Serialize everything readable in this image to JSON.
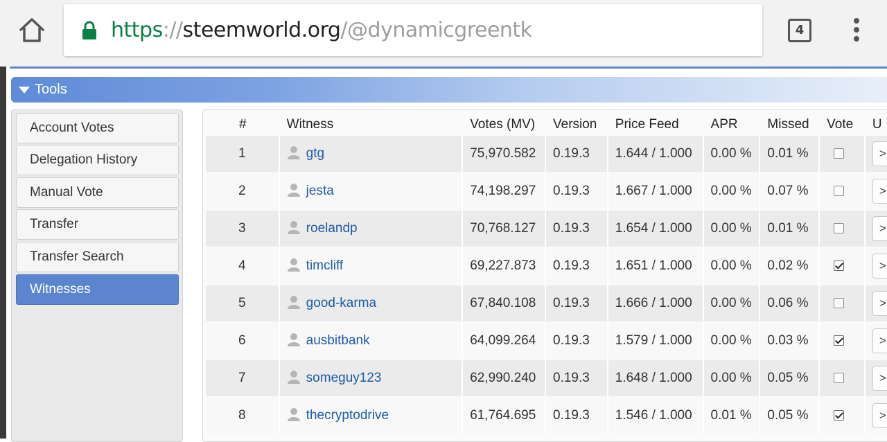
{
  "browser": {
    "url_scheme": "https",
    "url_sep": "://",
    "url_host": "steemworld.org",
    "url_path": "/@dynamicgreentk",
    "tab_count": "4",
    "icons": [
      "home-icon",
      "lock-icon",
      "tabs-icon",
      "more-menu-icon"
    ]
  },
  "tools": {
    "label": "Tools"
  },
  "sidebar": {
    "items": [
      {
        "label": "Account Votes"
      },
      {
        "label": "Delegation History"
      },
      {
        "label": "Manual Vote"
      },
      {
        "label": "Transfer"
      },
      {
        "label": "Transfer Search"
      },
      {
        "label": "Witnesses",
        "active": true
      }
    ]
  },
  "table": {
    "headers": {
      "num": "#",
      "witness": "Witness",
      "votes": "Votes (MV)",
      "version": "Version",
      "price_feed": "Price Feed",
      "apr": "APR",
      "missed": "Missed",
      "vote": "Vote",
      "extra": "U"
    },
    "rows": [
      {
        "num": "1",
        "witness": "gtg",
        "votes": "75,970.582",
        "version": "0.19.3",
        "price_feed": "1.644 / 1.000",
        "apr": "0.00 %",
        "missed": "0.01 %",
        "voted": false,
        "go": ">"
      },
      {
        "num": "2",
        "witness": "jesta",
        "votes": "74,198.297",
        "version": "0.19.3",
        "price_feed": "1.667 / 1.000",
        "apr": "0.00 %",
        "missed": "0.07 %",
        "voted": false,
        "go": ">"
      },
      {
        "num": "3",
        "witness": "roelandp",
        "votes": "70,768.127",
        "version": "0.19.3",
        "price_feed": "1.654 / 1.000",
        "apr": "0.00 %",
        "missed": "0.01 %",
        "voted": false,
        "go": ">"
      },
      {
        "num": "4",
        "witness": "timcliff",
        "votes": "69,227.873",
        "version": "0.19.3",
        "price_feed": "1.651 / 1.000",
        "apr": "0.00 %",
        "missed": "0.02 %",
        "voted": true,
        "go": ">"
      },
      {
        "num": "5",
        "witness": "good-karma",
        "votes": "67,840.108",
        "version": "0.19.3",
        "price_feed": "1.666 / 1.000",
        "apr": "0.00 %",
        "missed": "0.06 %",
        "voted": false,
        "go": ">"
      },
      {
        "num": "6",
        "witness": "ausbitbank",
        "votes": "64,099.264",
        "version": "0.19.3",
        "price_feed": "1.579 / 1.000",
        "apr": "0.00 %",
        "missed": "0.03 %",
        "voted": true,
        "go": ">"
      },
      {
        "num": "7",
        "witness": "someguy123",
        "votes": "62,990.240",
        "version": "0.19.3",
        "price_feed": "1.648 / 1.000",
        "apr": "0.00 %",
        "missed": "0.05 %",
        "voted": false,
        "go": ">"
      },
      {
        "num": "8",
        "witness": "thecryptodrive",
        "votes": "61,764.695",
        "version": "0.19.3",
        "price_feed": "1.546 / 1.000",
        "apr": "0.01 %",
        "missed": "0.05 %",
        "voted": true,
        "go": ">"
      }
    ]
  },
  "colors": {
    "accent": "#5b86cf",
    "link": "#1f5aa6",
    "secure_green": "#0b8043"
  }
}
